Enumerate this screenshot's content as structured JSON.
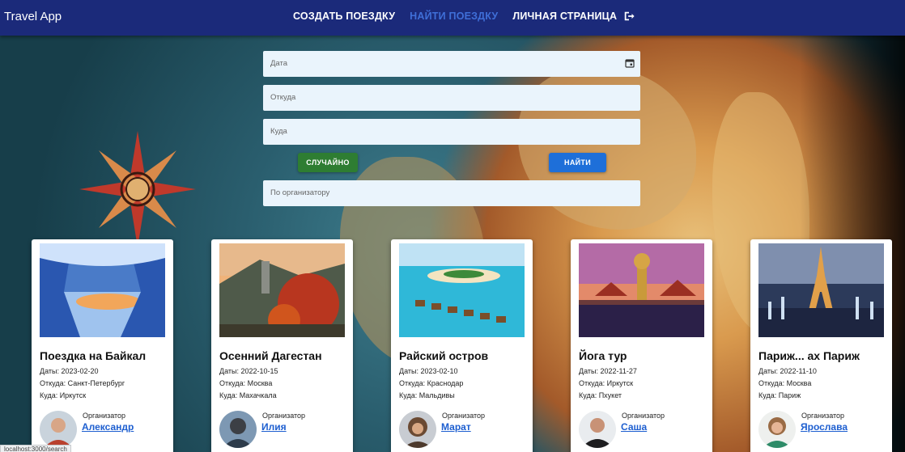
{
  "header": {
    "app_title": "Travel App",
    "nav": {
      "create": "СОЗДАТЬ ПОЕЗДКУ",
      "find": "НАЙТИ ПОЕЗДКУ",
      "profile": "ЛИЧНАЯ СТРАНИЦА"
    }
  },
  "search": {
    "date_placeholder": "Дата",
    "from_placeholder": "Откуда",
    "to_placeholder": "Куда",
    "random_label": "СЛУЧАЙНО",
    "find_label": "НАЙТИ",
    "organizer_placeholder": "По организатору"
  },
  "trips": [
    {
      "title": "Поездка на Байкал",
      "dates": "Даты: 2023-02-20",
      "from": "Откуда: Санкт-Петербург",
      "to": "Куда: Иркутск",
      "organizer_label": "Организатор",
      "organizer": "Александр"
    },
    {
      "title": "Осенний Дагестан",
      "dates": "Даты: 2022-10-15",
      "from": "Откуда: Москва",
      "to": "Куда: Махачкала",
      "organizer_label": "Организатор",
      "organizer": "Илия"
    },
    {
      "title": "Райский остров",
      "dates": "Даты: 2023-02-10",
      "from": "Откуда: Краснодар",
      "to": "Куда: Мальдивы",
      "organizer_label": "Организатор",
      "organizer": "Марат"
    },
    {
      "title": "Йога тур",
      "dates": "Даты: 2022-11-27",
      "from": "Откуда: Иркутск",
      "to": "Куда: Пхукет",
      "organizer_label": "Организатор",
      "organizer": "Саша"
    },
    {
      "title": "Париж... ах Париж",
      "dates": "Даты: 2022-11-10",
      "from": "Откуда: Москва",
      "to": "Куда: Париж",
      "organizer_label": "Организатор",
      "organizer": "Ярослава"
    }
  ],
  "statusbar": {
    "url": "localhost:3000/search"
  },
  "colors": {
    "header": "#1b2a7a",
    "active_nav": "#3f6fd8",
    "random_button": "#2e7d32",
    "find_button": "#1e6fd9",
    "link": "#1e5fd0"
  }
}
